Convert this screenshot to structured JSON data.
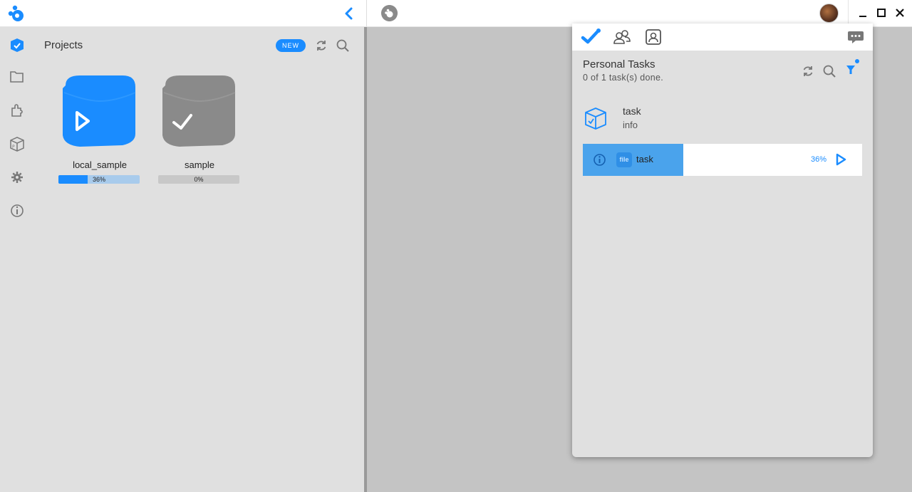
{
  "window": {
    "logo_icon": "brand-logo-icon",
    "controls": [
      "minimize-icon",
      "maximize-icon",
      "close-icon"
    ],
    "accent_color": "#1a8cff"
  },
  "sidebar": {
    "items": [
      {
        "icon": "projects-cube-icon",
        "active": true
      },
      {
        "icon": "folder-icon",
        "active": false
      },
      {
        "icon": "plugin-icon",
        "active": false
      },
      {
        "icon": "package-icon",
        "active": false
      },
      {
        "icon": "gear-icon",
        "active": false
      },
      {
        "icon": "info-icon",
        "active": false
      }
    ]
  },
  "projects": {
    "title": "Projects",
    "new_label": "NEW",
    "items": [
      {
        "name": "local_sample",
        "progress_label": "36%",
        "progress": 0.36,
        "status": "running",
        "color": "#1a8cff"
      },
      {
        "name": "sample",
        "progress_label": "0%",
        "progress": 0.0,
        "status": "done",
        "color": "#8a8a8a"
      }
    ]
  },
  "task_panel": {
    "tabs": [
      "tasks-check-icon",
      "team-icon",
      "contact-icon"
    ],
    "title": "Personal Tasks",
    "subtitle": "0 of 1 task(s) done.",
    "group": {
      "name": "task",
      "info": "info",
      "icon": "task-box-icon"
    },
    "task_row": {
      "file_badge": "file",
      "name": "task",
      "percent_label": "36%",
      "progress": 0.36
    }
  }
}
